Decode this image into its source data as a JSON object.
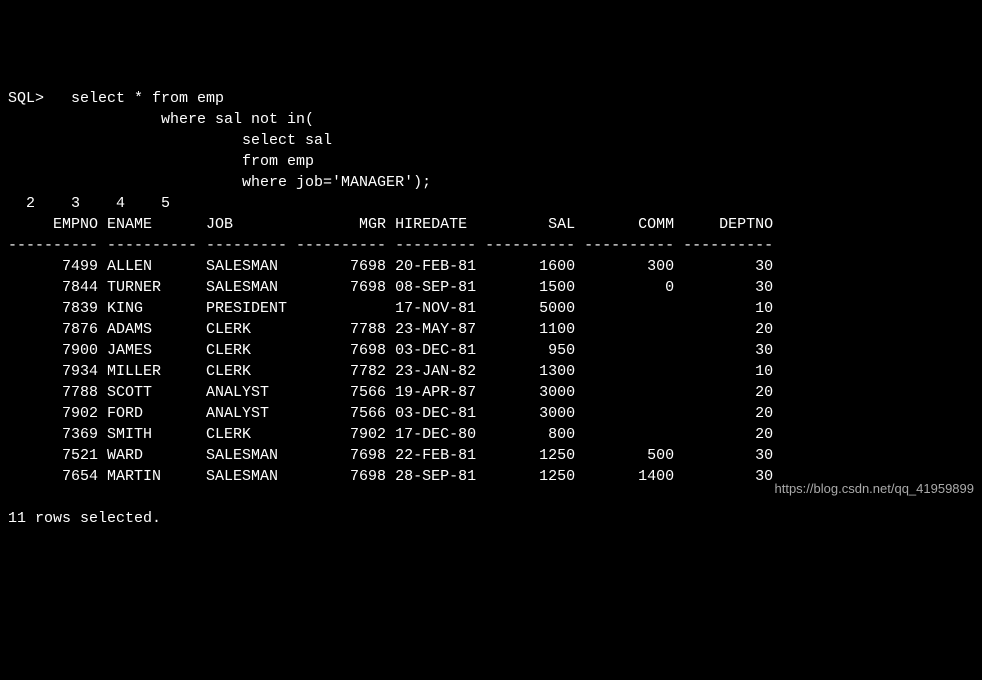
{
  "prompt": "SQL>",
  "query": {
    "line1": "   select * from emp",
    "line2": "                 where sal not in(",
    "line3": "                          select sal",
    "line4": "                          from emp",
    "line5": "                          where job='MANAGER');"
  },
  "line_numbers": "  2    3    4    5",
  "headers": {
    "empno": "EMPNO",
    "ename": "ENAME",
    "job": "JOB",
    "mgr": "MGR",
    "hiredate": "HIREDATE",
    "sal": "SAL",
    "comm": "COMM",
    "deptno": "DEPTNO"
  },
  "separator": "---------- ---------- --------- ---------- --------- ---------- ---------- ----------",
  "rows": [
    {
      "empno": "7499",
      "ename": "ALLEN",
      "job": "SALESMAN",
      "mgr": "7698",
      "hiredate": "20-FEB-81",
      "sal": "1600",
      "comm": "300",
      "deptno": "30"
    },
    {
      "empno": "7844",
      "ename": "TURNER",
      "job": "SALESMAN",
      "mgr": "7698",
      "hiredate": "08-SEP-81",
      "sal": "1500",
      "comm": "0",
      "deptno": "30"
    },
    {
      "empno": "7839",
      "ename": "KING",
      "job": "PRESIDENT",
      "mgr": "",
      "hiredate": "17-NOV-81",
      "sal": "5000",
      "comm": "",
      "deptno": "10"
    },
    {
      "empno": "7876",
      "ename": "ADAMS",
      "job": "CLERK",
      "mgr": "7788",
      "hiredate": "23-MAY-87",
      "sal": "1100",
      "comm": "",
      "deptno": "20"
    },
    {
      "empno": "7900",
      "ename": "JAMES",
      "job": "CLERK",
      "mgr": "7698",
      "hiredate": "03-DEC-81",
      "sal": "950",
      "comm": "",
      "deptno": "30"
    },
    {
      "empno": "7934",
      "ename": "MILLER",
      "job": "CLERK",
      "mgr": "7782",
      "hiredate": "23-JAN-82",
      "sal": "1300",
      "comm": "",
      "deptno": "10"
    },
    {
      "empno": "7788",
      "ename": "SCOTT",
      "job": "ANALYST",
      "mgr": "7566",
      "hiredate": "19-APR-87",
      "sal": "3000",
      "comm": "",
      "deptno": "20"
    },
    {
      "empno": "7902",
      "ename": "FORD",
      "job": "ANALYST",
      "mgr": "7566",
      "hiredate": "03-DEC-81",
      "sal": "3000",
      "comm": "",
      "deptno": "20"
    },
    {
      "empno": "7369",
      "ename": "SMITH",
      "job": "CLERK",
      "mgr": "7902",
      "hiredate": "17-DEC-80",
      "sal": "800",
      "comm": "",
      "deptno": "20"
    },
    {
      "empno": "7521",
      "ename": "WARD",
      "job": "SALESMAN",
      "mgr": "7698",
      "hiredate": "22-FEB-81",
      "sal": "1250",
      "comm": "500",
      "deptno": "30"
    },
    {
      "empno": "7654",
      "ename": "MARTIN",
      "job": "SALESMAN",
      "mgr": "7698",
      "hiredate": "28-SEP-81",
      "sal": "1250",
      "comm": "1400",
      "deptno": "30"
    }
  ],
  "result_msg": "11 rows selected.",
  "watermark": "https://blog.csdn.net/qq_41959899"
}
